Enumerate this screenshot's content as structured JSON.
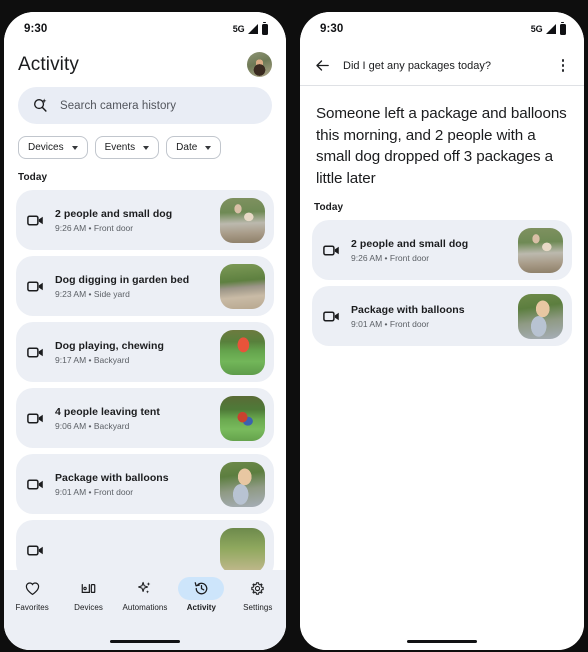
{
  "left_phone": {
    "status_bar": {
      "time": "9:30",
      "network": "5G",
      "signal_icon": "signal-triangle-icon",
      "battery_icon": "battery-full-icon"
    },
    "header": {
      "title": "Activity",
      "avatar_name": "user-avatar"
    },
    "search": {
      "placeholder": "Search camera history",
      "icon": "search-sparkle-icon"
    },
    "filters": [
      {
        "label": "Devices",
        "name": "filter-chip-devices"
      },
      {
        "label": "Events",
        "name": "filter-chip-events"
      },
      {
        "label": "Date",
        "name": "filter-chip-date"
      }
    ],
    "day_label": "Today",
    "events": [
      {
        "title": "2 people and small dog",
        "time": "9:26 AM",
        "separator": " • ",
        "location": "Front door",
        "subtitle": "9:26 AM • Front door",
        "thumb": "thumb-a"
      },
      {
        "title": "Dog digging in garden bed",
        "time": "9:23 AM",
        "separator": " • ",
        "location": "Side yard",
        "subtitle": "9:23 AM • Side yard",
        "thumb": "thumb-b"
      },
      {
        "title": "Dog playing, chewing",
        "time": "9:17 AM",
        "separator": " • ",
        "location": "Backyard",
        "subtitle": "9:17 AM • Backyard",
        "thumb": "thumb-c"
      },
      {
        "title": "4 people leaving tent",
        "time": "9:06 AM",
        "separator": " • ",
        "location": "Backyard",
        "subtitle": "9:06 AM • Backyard",
        "thumb": "thumb-d"
      },
      {
        "title": "Package with balloons",
        "time": "9:01 AM",
        "separator": " • ",
        "location": "Front door",
        "subtitle": "9:01 AM • Front door",
        "thumb": "thumb-e"
      }
    ],
    "bottom_nav": [
      {
        "label": "Favorites",
        "icon": "heart-icon",
        "active": false
      },
      {
        "label": "Devices",
        "icon": "devices-icon",
        "active": false
      },
      {
        "label": "Automations",
        "icon": "sparkles-icon",
        "active": false
      },
      {
        "label": "Activity",
        "icon": "history-icon",
        "active": true
      },
      {
        "label": "Settings",
        "icon": "gear-icon",
        "active": false
      }
    ]
  },
  "right_phone": {
    "status_bar": {
      "time": "9:30",
      "network": "5G",
      "signal_icon": "signal-triangle-icon",
      "battery_icon": "battery-full-icon"
    },
    "appbar": {
      "title": "Did I get any packages today?",
      "back_icon": "back-arrow-icon",
      "more_icon": "overflow-menu-icon"
    },
    "summary": "Someone left a package and balloons this morning, and 2 people with a small dog dropped off 3 packages a little later",
    "day_label": "Today",
    "results": [
      {
        "title": "2 people and small dog",
        "time": "9:26 AM",
        "separator": " • ",
        "location": "Front door",
        "subtitle": "9:26 AM • Front door",
        "thumb": "thumb-a"
      },
      {
        "title": "Package with balloons",
        "time": "9:01 AM",
        "separator": " • ",
        "location": "Front door",
        "subtitle": "9:01 AM • Front door",
        "thumb": "thumb-e"
      }
    ]
  },
  "colors": {
    "accent_pill": "#cde5fb",
    "card_surface": "#eceff5",
    "search_surface": "#e9edf5",
    "text_primary": "#1b1c1e",
    "text_secondary": "#5c6066",
    "frame": "#0e0e0e"
  }
}
